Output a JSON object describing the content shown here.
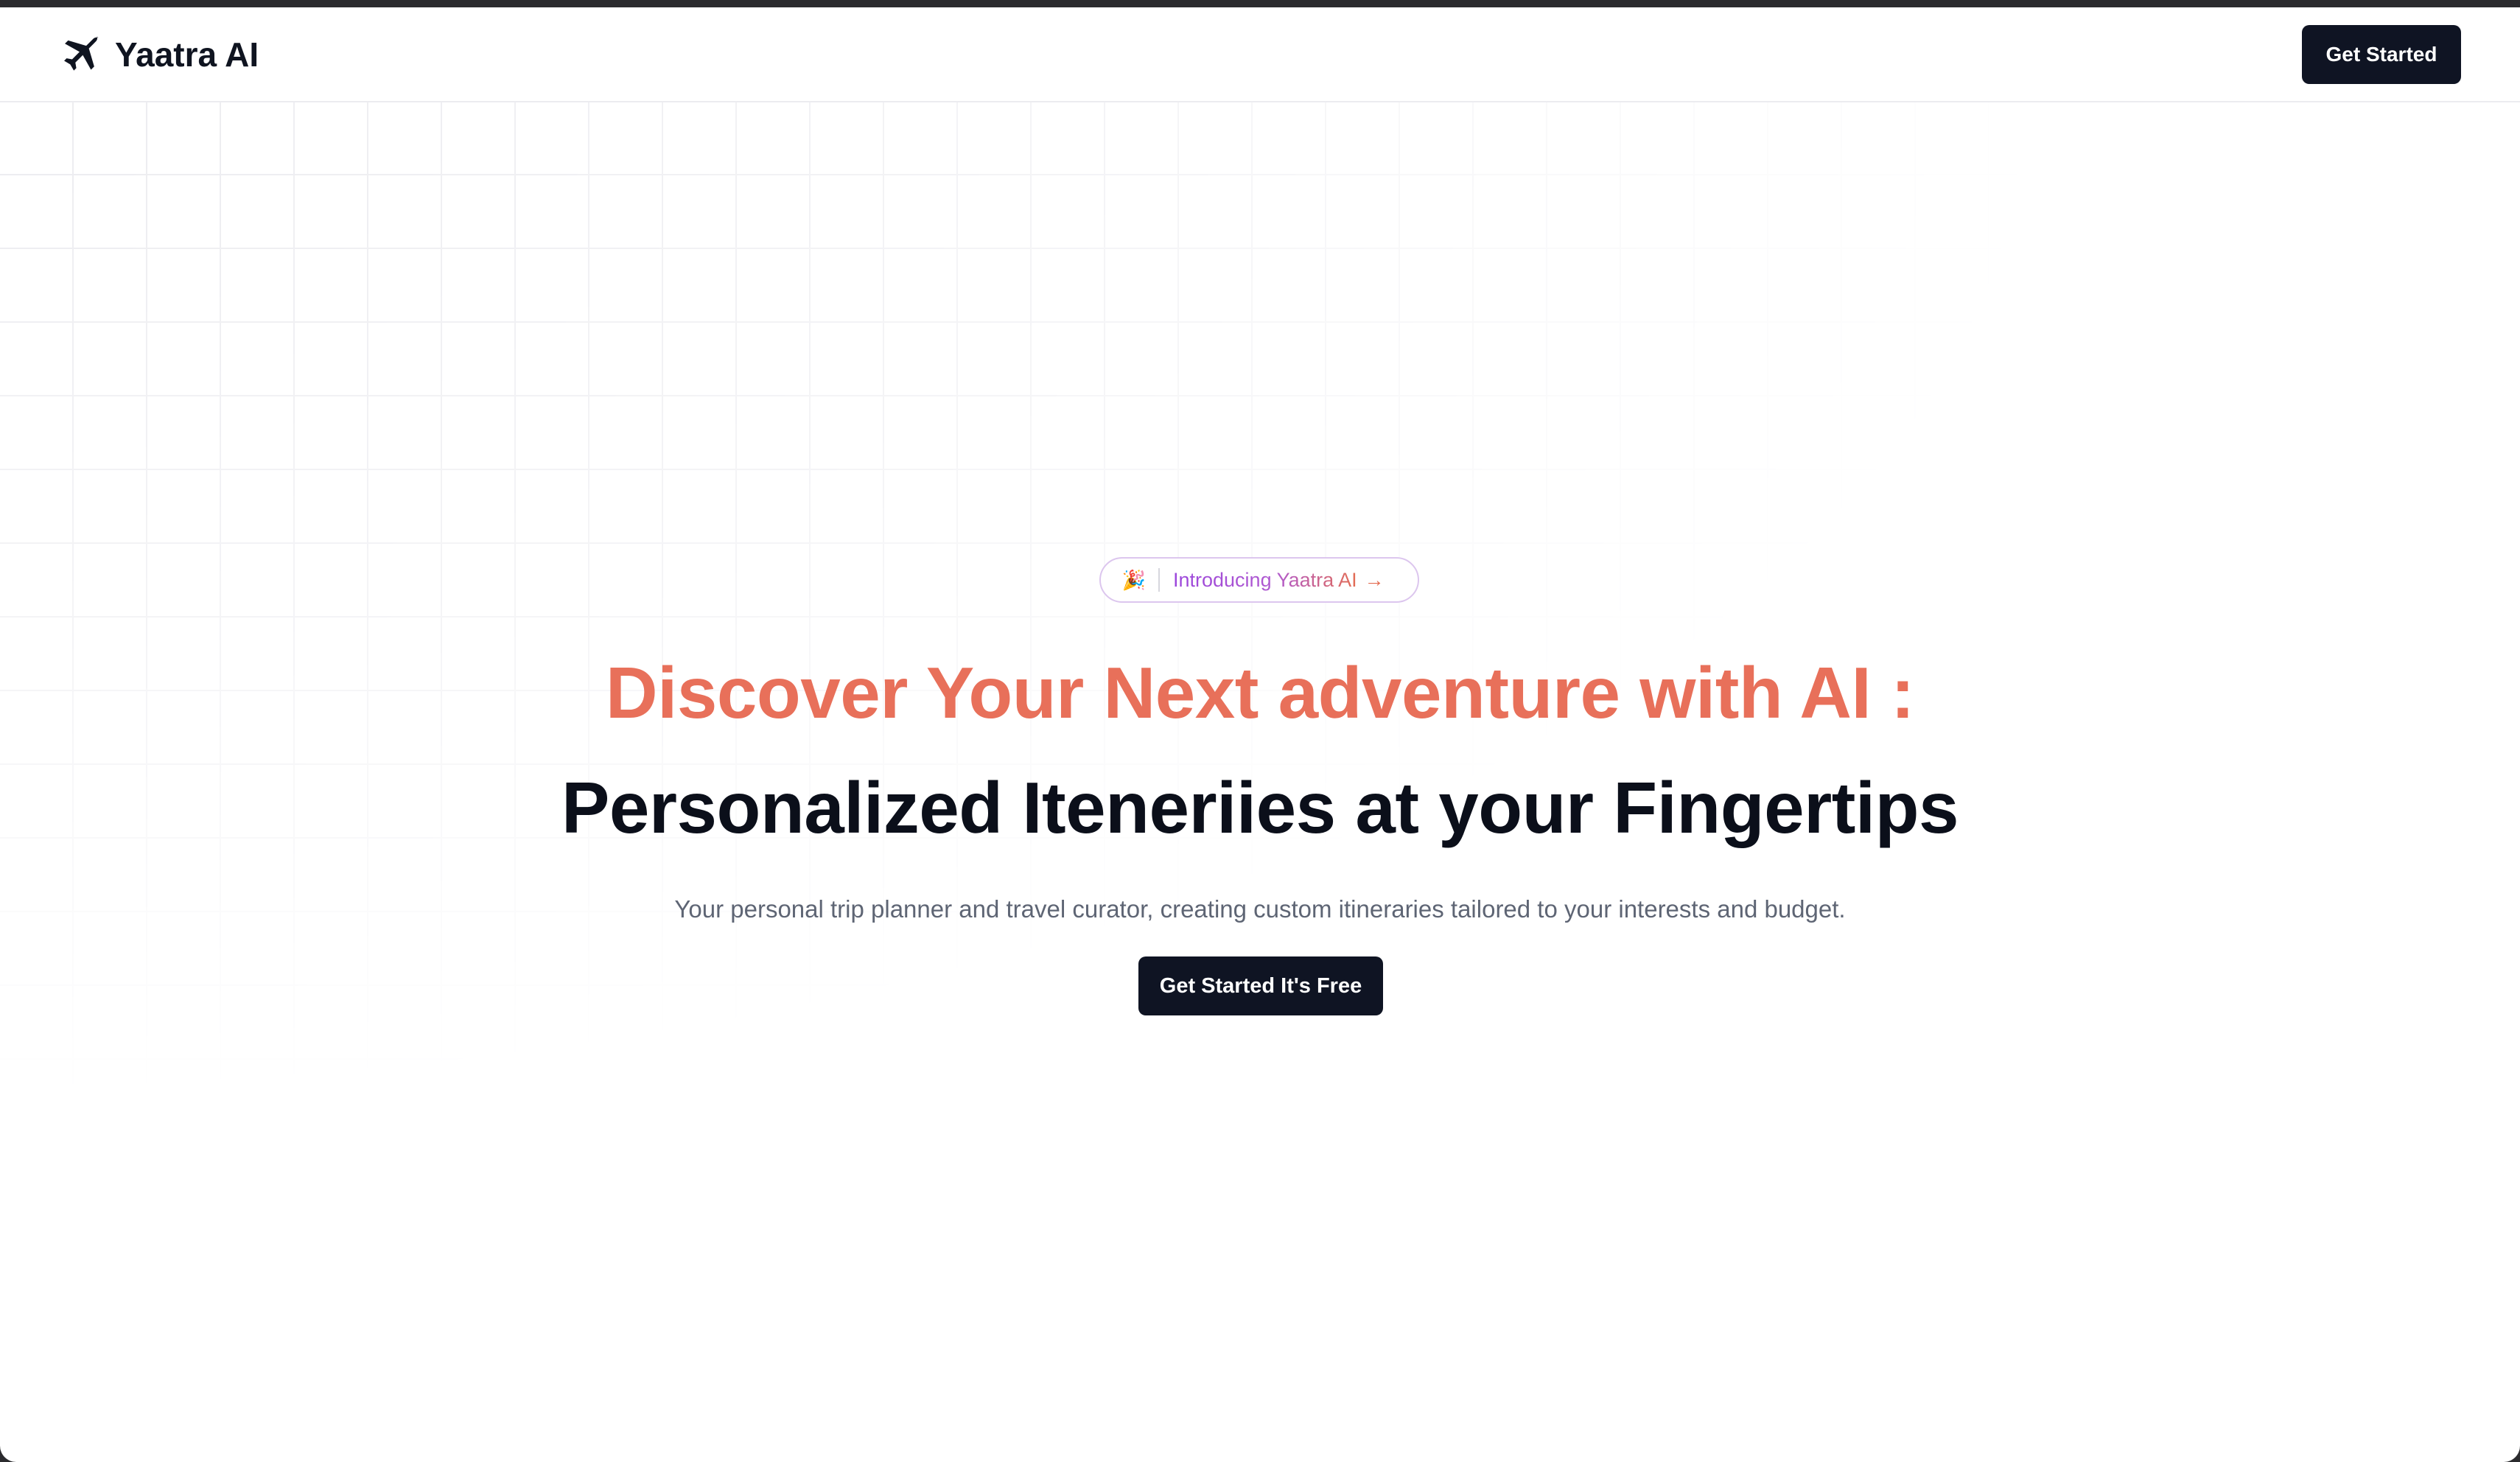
{
  "header": {
    "logo_text": "Yaatra AI",
    "logo_icon": "airplane-icon",
    "cta_label": "Get Started"
  },
  "hero": {
    "badge": {
      "emoji": "🎉",
      "label": "Introducing Yaatra AI",
      "arrow": "→"
    },
    "headline_primary": "Discover Your Next adventure with AI :",
    "headline_secondary": "Personalized Iteneriies at your Fingertips",
    "subtitle": "Your personal trip planner and travel curator, creating custom itineraries tailored to your interests and budget.",
    "cta_label": "Get Started It's Free"
  },
  "colors": {
    "accent": "#e8705a",
    "badge_text": "#9a4bd8",
    "button_bg": "#0f1423",
    "headline_dark": "#0b0f1a",
    "subtitle_text": "#5e6574"
  }
}
